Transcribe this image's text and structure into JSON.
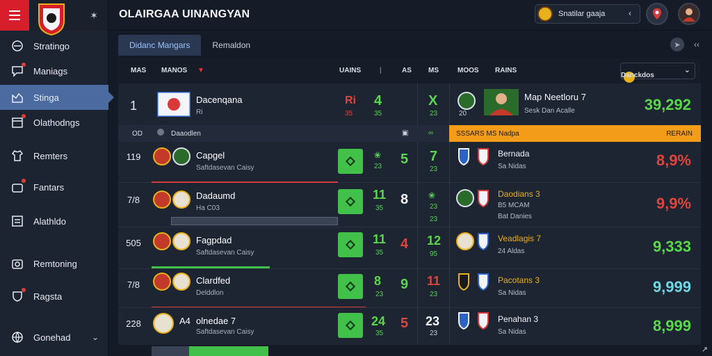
{
  "app": {
    "title": "OLAIRGAA UINANGYAN"
  },
  "sidebar": {
    "items": [
      {
        "label": "Stratingo"
      },
      {
        "label": "Maniags"
      },
      {
        "label": "Stinga"
      },
      {
        "label": "Olathodngs"
      },
      {
        "label": "Remters"
      },
      {
        "label": "Fantars"
      },
      {
        "label": "Alathldo"
      },
      {
        "label": "Remtoning"
      },
      {
        "label": "Ragsta"
      },
      {
        "label": "Gonehad"
      }
    ]
  },
  "topbar": {
    "search_text": "Snatilar gaaja"
  },
  "tabs": [
    {
      "label": "Didanc Mangars"
    },
    {
      "label": "Remaldon"
    }
  ],
  "tab_icons": {
    "right_label": "‹‹"
  },
  "table": {
    "headers": {
      "h1": "MAS",
      "h2": "MANOS",
      "h3": "UAINS",
      "h4": "AS",
      "h5": "MS",
      "h6": "MOOS",
      "h7": "RAINS"
    },
    "sort_label": "Danckdos",
    "subhead": {
      "a": "OD",
      "b": "Daaodlen"
    },
    "orange": {
      "left": "SSSARS MS Nadpa",
      "right": "RERAIN"
    },
    "top": {
      "rank": "1",
      "name": "Dacenqana",
      "sub": "Ri",
      "a_top": "Ri",
      "a_bot": "35",
      "b": "4",
      "b_bot": "35",
      "c": "X",
      "c_bot": "23",
      "r_name": "Map Neetloru 7",
      "r_sub": "Sesk Dan Acalle",
      "r_sub2": "20",
      "r_val": "39,292"
    },
    "rows": [
      {
        "rank": "119",
        "name": "Capgel",
        "sub": "Saftdasevan Caisy",
        "s1": "23",
        "b": "5",
        "c": "7",
        "c_bot": "23",
        "r_name": "Bernada",
        "r_sub": "Sa Nidas",
        "r_val": "8,9%",
        "b_color": "green",
        "v_color": "red"
      },
      {
        "rank": "7/8",
        "name": "Dadaumd",
        "sub": "Ha C03",
        "s1": "11",
        "s2": "35",
        "b": "8",
        "c": "23",
        "c_bot": "23",
        "r_name": "Daodians 3",
        "r_sub": "B5 MCAM",
        "r_sub2": "Bat Danies",
        "r_val": "9,9%",
        "b_color": "white",
        "v_color": "red"
      },
      {
        "rank": "505",
        "name": "Fagpdad",
        "sub": "Saftdasevan Caisy",
        "s1": "11",
        "s2": "35",
        "b": "4",
        "c": "12",
        "c_bot": "95",
        "r_name": "Veadlagis 7",
        "r_sub": "24 Aldas",
        "r_val": "9,333",
        "b_color": "red",
        "v_color": "green"
      },
      {
        "rank": "7/8",
        "name": "Clardfed",
        "sub": "Delddlon",
        "s1": "8",
        "s2": "23",
        "b": "9",
        "c": "11",
        "c_bot": "23",
        "r_name": "Pacotans 3",
        "r_sub": "Sa Nidas",
        "r_val": "9,999",
        "b_color": "green",
        "v_color": "cyan"
      },
      {
        "rank": "228",
        "name": "olnedae 7",
        "pre": "A4",
        "sub": "Saftdasevan Caisy",
        "s1": "24",
        "s2": "35",
        "b": "5",
        "c": "23",
        "c_bot": "23",
        "r_name": "Penahan 3",
        "r_sub": "Sa Nidas",
        "r_val": "8,999",
        "b_color": "red",
        "v_color": "green"
      }
    ]
  }
}
